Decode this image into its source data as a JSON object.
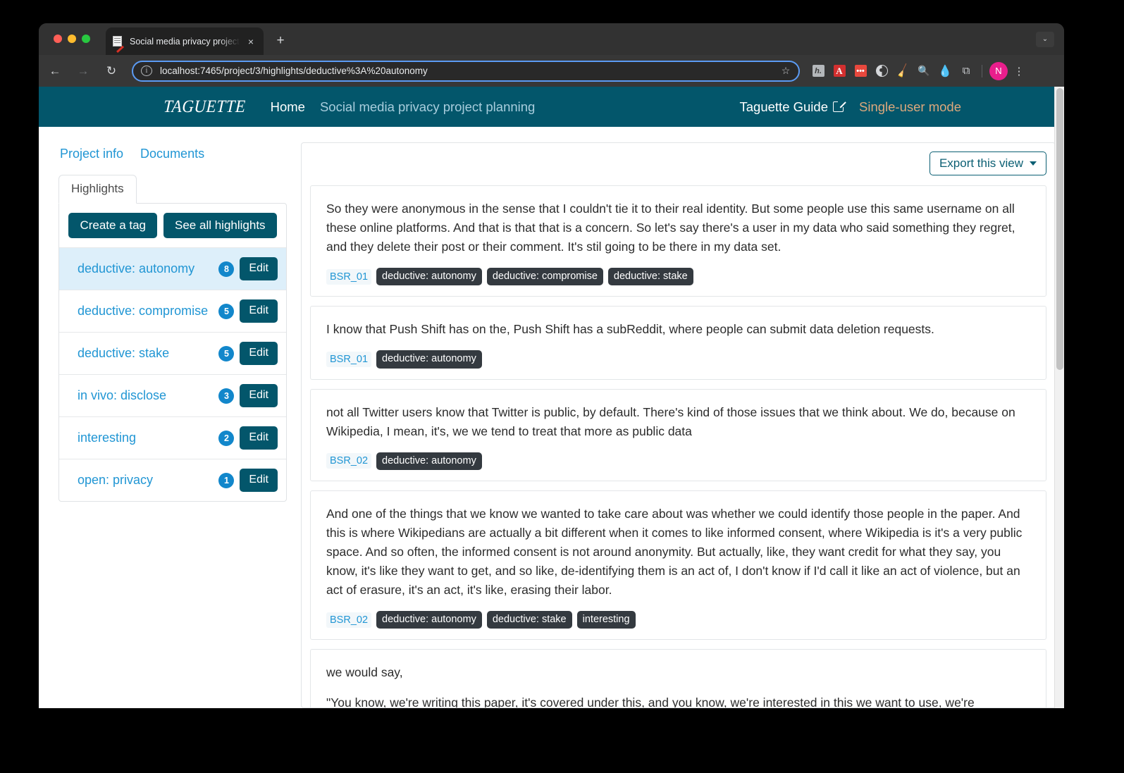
{
  "browser": {
    "tab": {
      "title": "Social media privacy project p",
      "favicon": "document-pencil-icon",
      "close_label": "×"
    },
    "new_tab_label": "+",
    "tab_list_label": "⌄",
    "nav": {
      "back": "←",
      "forward": "→",
      "reload": "↻"
    },
    "omnibox": {
      "url": "localhost:7465/project/3/highlights/deductive%3A%20autonomy",
      "info_icon": "ⓘ",
      "star_icon": "☆"
    },
    "extensions": [
      {
        "name": "hypothesis-extension",
        "glyph": "h."
      },
      {
        "name": "adobe-acrobat-extension",
        "glyph": "A"
      },
      {
        "name": "red-dots-extension",
        "glyph": "•••"
      },
      {
        "name": "dark-reader-extension",
        "glyph": ""
      },
      {
        "name": "broom-extension",
        "glyph": "🧹"
      },
      {
        "name": "magnifier-extension",
        "glyph": "🔍"
      },
      {
        "name": "drop-extension",
        "glyph": "●"
      },
      {
        "name": "puzzle-extensions-menu",
        "glyph": "⧉"
      }
    ],
    "avatar_initial": "N",
    "menu_glyph": "⋮"
  },
  "navbar": {
    "logo": "TAGUETTE",
    "home": "Home",
    "project": "Social media privacy project planning",
    "guide": "Taguette Guide",
    "mode": "Single-user mode"
  },
  "sidebar": {
    "links": [
      {
        "label": "Project info",
        "name": "sidebar-link-project-info"
      },
      {
        "label": "Documents",
        "name": "sidebar-link-documents"
      }
    ],
    "tab": "Highlights",
    "buttons": {
      "create_tag": "Create a tag",
      "see_all": "See all highlights"
    },
    "edit_label": "Edit",
    "tags": [
      {
        "label": "deductive: autonomy",
        "count": "8",
        "selected": true
      },
      {
        "label": "deductive: compromise",
        "count": "5",
        "selected": false
      },
      {
        "label": "deductive: stake",
        "count": "5",
        "selected": false
      },
      {
        "label": "in vivo: disclose",
        "count": "3",
        "selected": false
      },
      {
        "label": "interesting",
        "count": "2",
        "selected": false
      },
      {
        "label": "open: privacy",
        "count": "1",
        "selected": false
      }
    ]
  },
  "main": {
    "export_button": "Export this view",
    "highlights": [
      {
        "paragraphs": [
          "So they were anonymous in the sense that I couldn't tie it to their real identity. But some people use this same username on all these online platforms. And that is that that is a concern. So let's say there's a user in my data who said something they regret, and they delete their post or their comment. It's stil going to be there in my data set."
        ],
        "document": "BSR_01",
        "tags": [
          "deductive: autonomy",
          "deductive: compromise",
          "deductive: stake"
        ]
      },
      {
        "paragraphs": [
          "I know that Push Shift has on the, Push Shift has a subReddit, where people can submit data deletion requests."
        ],
        "document": "BSR_01",
        "tags": [
          "deductive: autonomy"
        ]
      },
      {
        "paragraphs": [
          "not all Twitter users know that Twitter is public, by default. There's kind of those issues that we think about. We do, because on Wikipedia, I mean, it's, we we tend to treat that more as public data"
        ],
        "document": "BSR_02",
        "tags": [
          "deductive: autonomy"
        ]
      },
      {
        "paragraphs": [
          "And one of the things that we know we wanted to take care about was whether we could identify those people in the paper. And this is where Wikipedians are actually a bit different when it comes to like informed consent, where Wikipedia is it's a very public space. And so often, the informed consent is not around anonymity. But actually, like, they want credit for what they say, you know, it's like they want to get, and so like, de-identifying them is an act of, I don't know if I'd call it like an act of violence, but an act of erasure, it's an act, it's like, erasing their labor."
        ],
        "document": "BSR_02",
        "tags": [
          "deductive: autonomy",
          "deductive: stake",
          "interesting"
        ]
      },
      {
        "paragraphs": [
          "we would say,",
          "\"You know, we're writing this paper, it's covered under this, and you know, we're interested in this we want to use, we're interested in using your case, as an example. Can you talk about whether you thought this was conflict or not conflict?"
        ],
        "document": "",
        "tags": []
      }
    ]
  },
  "colors": {
    "brand_teal": "#03566b",
    "link_blue": "#2196d4",
    "badge_blue": "#1287cb",
    "chip_dark": "#343a40",
    "mode_tan": "#dda87c",
    "selected_row": "#ddeffa"
  }
}
